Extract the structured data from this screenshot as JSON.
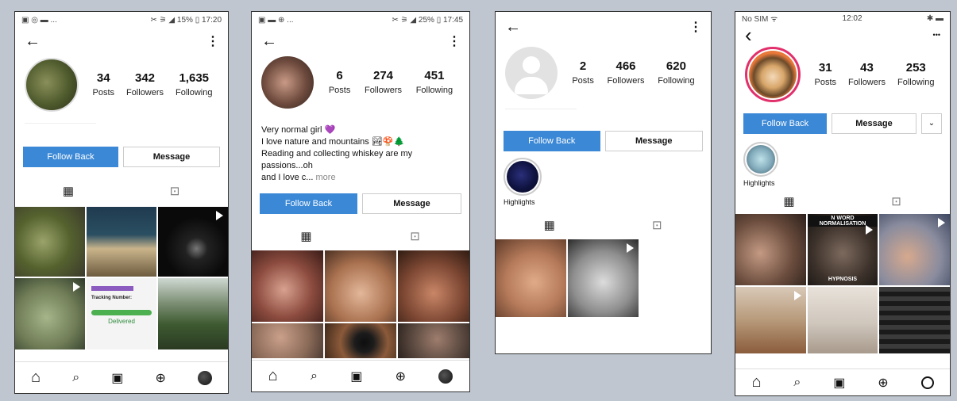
{
  "phone1": {
    "status": {
      "left": "▣ ◎ ▬ ...",
      "right": "✂ ⚞ ◢ 15% ▯ 17:20"
    },
    "stats": [
      {
        "n": "34",
        "l": "Posts"
      },
      {
        "n": "342",
        "l": "Followers"
      },
      {
        "n": "1,635",
        "l": "Following"
      }
    ],
    "follow_label": "Follow Back",
    "message_label": "Message",
    "tile_text": {
      "tracking": "Tracking Number:",
      "delivered": "Delivered"
    }
  },
  "phone2": {
    "status": {
      "left": "▣ ▬ ⊕ ...",
      "right": "✂ ⚞ ◢ 25% ▯ 17:45"
    },
    "stats": [
      {
        "n": "6",
        "l": "Posts"
      },
      {
        "n": "274",
        "l": "Followers"
      },
      {
        "n": "451",
        "l": "Following"
      }
    ],
    "bio": [
      "Very normal girl 💜",
      "I love nature and mountains 🏞🍄🌲",
      "Reading and collecting whiskey are my passions...oh",
      "and I love c..."
    ],
    "bio_more": "more",
    "follow_label": "Follow Back",
    "message_label": "Message"
  },
  "phone3": {
    "stats": [
      {
        "n": "2",
        "l": "Posts"
      },
      {
        "n": "466",
        "l": "Followers"
      },
      {
        "n": "620",
        "l": "Following"
      }
    ],
    "follow_label": "Follow Back",
    "message_label": "Message",
    "highlights_label": "Highlights"
  },
  "phone4": {
    "status": {
      "left": "No SIM ᯤ",
      "center": "12:02",
      "right": "✱ ▬"
    },
    "stats": [
      {
        "n": "31",
        "l": "Posts"
      },
      {
        "n": "43",
        "l": "Followers"
      },
      {
        "n": "253",
        "l": "Following"
      }
    ],
    "follow_label": "Follow Back",
    "message_label": "Message",
    "highlights_label": "Highlights",
    "tile_text": {
      "nword": "N WORD NORMALISATION",
      "hypnosis": "HYPNOSIS"
    }
  },
  "icons": {
    "back": "←",
    "back_ios": "‹",
    "menu": "⋮",
    "menu_ios": "•••",
    "grid": "▦",
    "tagged": "⊡",
    "home": "⌂",
    "search": "⌕",
    "reels": "▣",
    "shop": "⊕",
    "chevron": "⌄"
  },
  "colors": {
    "follow": "#3b88d6",
    "background": "#bfc6cf"
  }
}
